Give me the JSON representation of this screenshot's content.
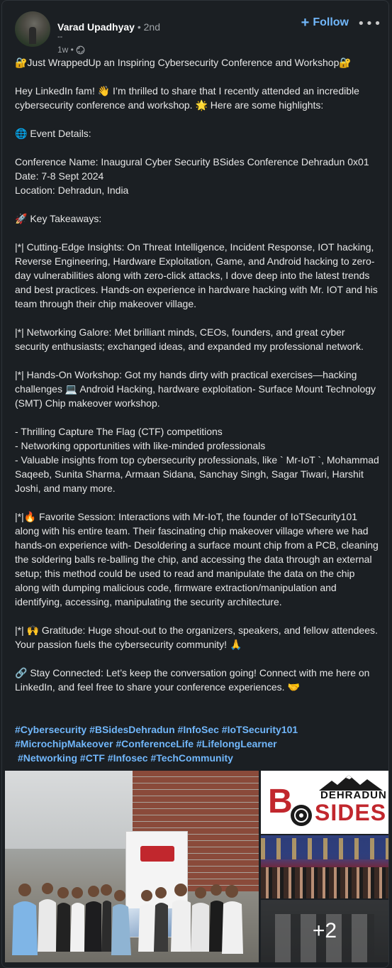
{
  "post": {
    "author": {
      "name": "Varad Upadhyay",
      "degree": "• 2nd",
      "headline": "--",
      "time": "1w •"
    },
    "follow_label": "Follow",
    "more_label": "•••",
    "body": [
      "🔐Just WrappedUp an Inspiring Cybersecurity Conference and Workshop🔐",
      "",
      "Hey LinkedIn fam! 👋 I’m thrilled to share that I recently attended an incredible cybersecurity conference and workshop. 🌟 Here are some highlights:",
      "",
      "🌐 Event Details:",
      "",
      "Conference Name: Inaugural Cyber Security BSides Conference Dehradun 0x01",
      "Date: 7-8 Sept 2024",
      "Location: Dehradun, India",
      "",
      "🚀 Key Takeaways:",
      "",
      "|*| Cutting-Edge Insights: On Threat Intelligence, Incident Response, IOT hacking, Reverse Engineering, Hardware Exploitation, Game, and Android hacking to zero-day vulnerabilities along with zero-click attacks, I dove deep into the latest trends and best practices. Hands-on experience in hardware hacking with Mr. IOT and his team through their chip makeover village.",
      "",
      "|*| Networking Galore: Met brilliant minds, CEOs, founders, and great cyber security enthusiasts; exchanged ideas, and expanded my professional network.",
      "",
      "|*| Hands-On Workshop: Got my hands dirty with practical exercises—hacking challenges 💻 Android Hacking, hardware exploitation- Surface Mount Technology (SMT) Chip makeover workshop.",
      "",
      "- Thrilling Capture The Flag (CTF) competitions",
      "- Networking opportunities with like-minded professionals",
      "- Valuable insights from top cybersecurity professionals, like ` Mr-IoT `, Mohammad Saqeeb, Sunita Sharma, Armaan Sidana, Sanchay Singh, Sagar Tiwari, Harshit Joshi, and many more.",
      "",
      "|*|🔥 Favorite Session: Interactions with Mr-IoT, the founder of IoTSecurity101 along with his entire team. Their fascinating chip makeover village where we had hands-on experience with- Desoldering a surface mount chip from a PCB, cleaning the soldering balls re-balling the chip, and accessing the data through an external setup; this method could be used to read and manipulate the data on the chip along with dumping malicious code, firmware extraction/manipulation and identifying, accessing, manipulating the security architecture.",
      "",
      "|*| 🙌 Gratitude: Huge shout-out to the organizers, speakers, and fellow attendees. Your passion fuels the cybersecurity community! 🙏",
      "",
      "🔗 Stay Connected: Let’s keep the conversation going! Connect with me here on LinkedIn, and feel free to share your conference experiences. 🤝"
    ],
    "hashtags_line1": [
      "#Cybersecurity",
      "#BSidesDehradun",
      "#InfoSec",
      "#IoTSecurity101"
    ],
    "hashtags_line2": [
      "#MicrochipMakeover",
      "#ConferenceLife",
      "#LifelongLearner"
    ],
    "hashtags_line3": [
      "#Networking",
      "#CTF",
      "#Infosec",
      "#TechCommunity"
    ],
    "media": {
      "logo_b": "B",
      "logo_sides": "SIDES",
      "logo_city": "DEHRADUN",
      "more_count": "+2"
    },
    "colors": {
      "accent": "#71b7fb",
      "card_bg": "#1b1f23",
      "brand_red": "#c1272d"
    }
  }
}
